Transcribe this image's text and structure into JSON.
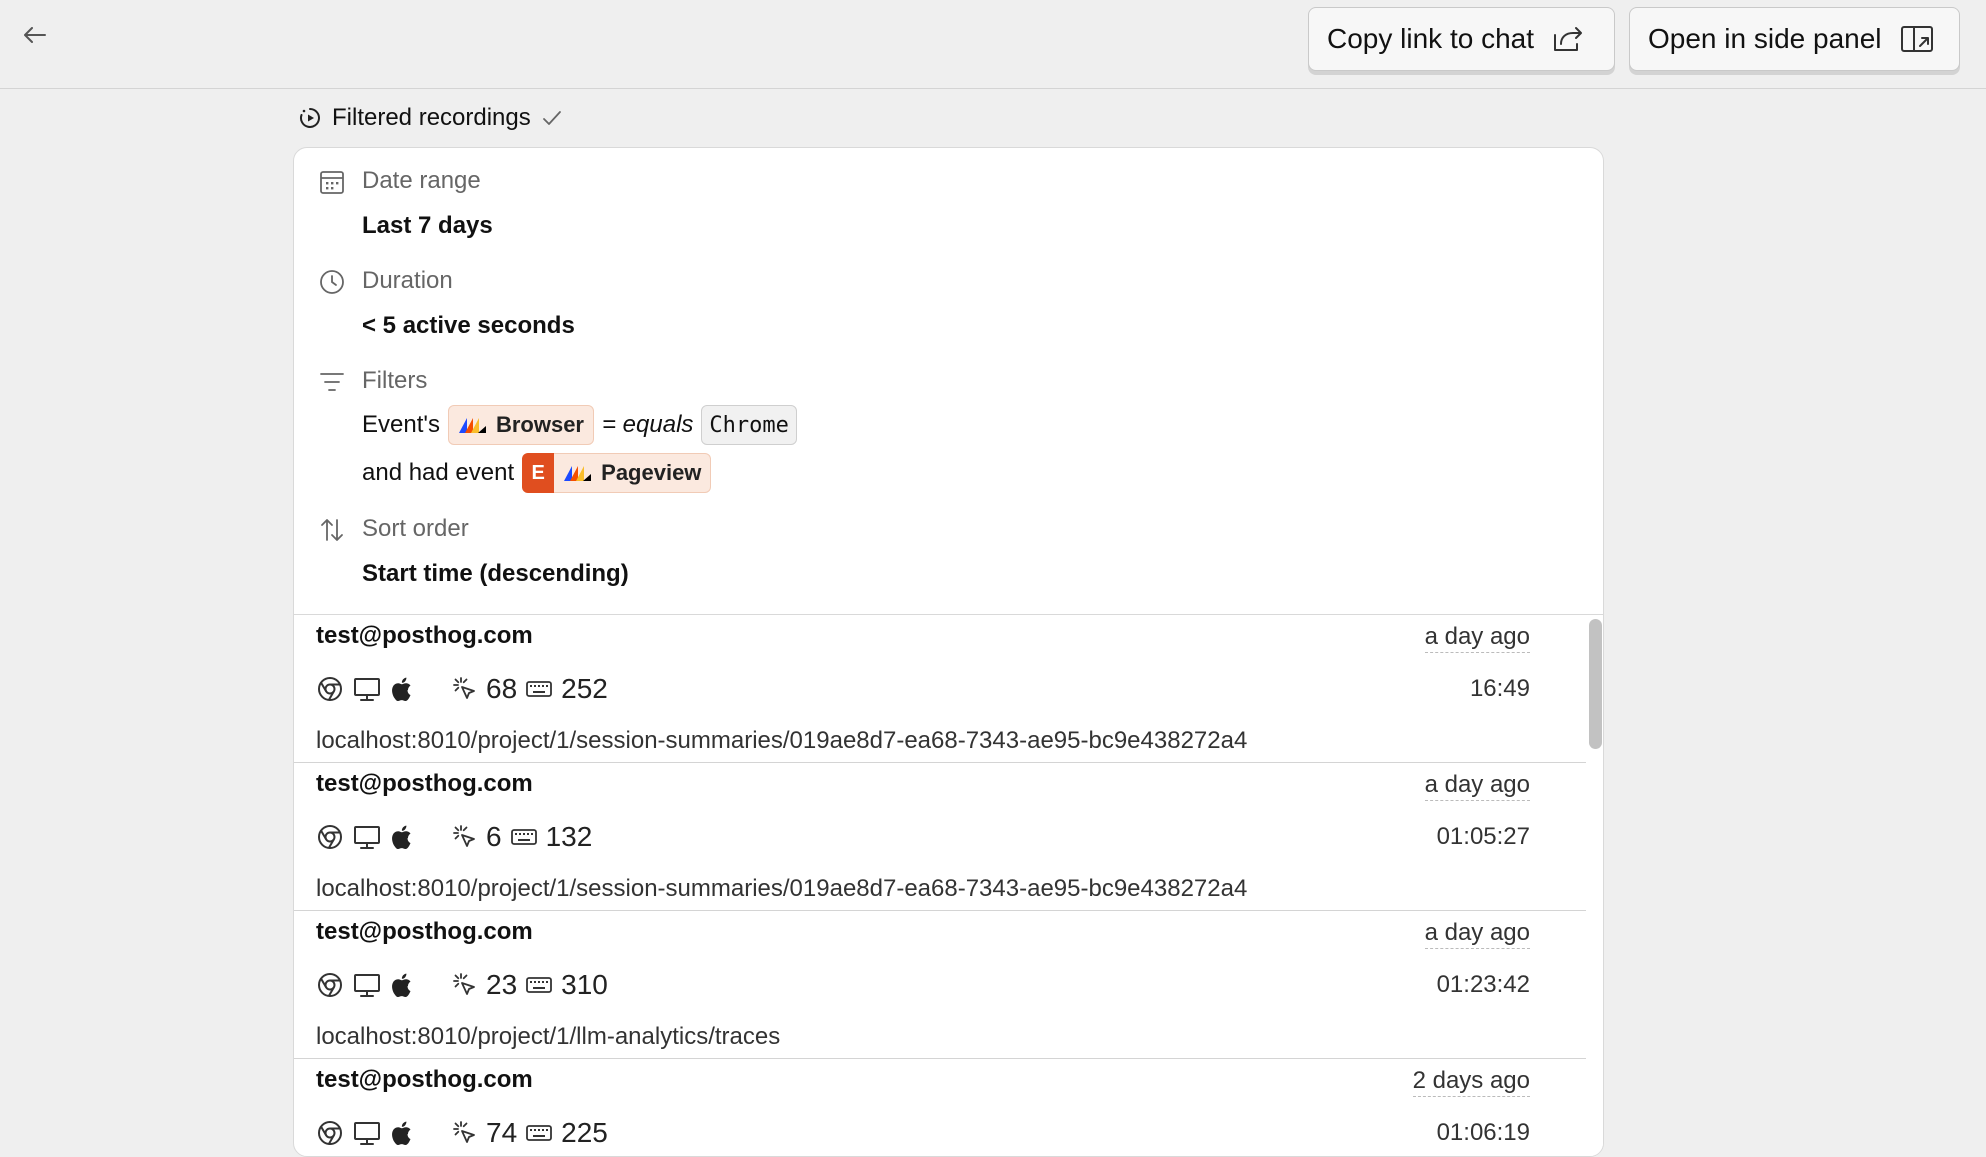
{
  "toolbar": {
    "copy_link_label": "Copy link to chat",
    "side_panel_label": "Open in side panel"
  },
  "section": {
    "title": "Filtered recordings"
  },
  "filters": {
    "date_range_label": "Date range",
    "date_range_value": "Last 7 days",
    "duration_label": "Duration",
    "duration_value": "< 5 active seconds",
    "filters_label": "Filters",
    "property_prefix": "Event's",
    "property_name": "Browser",
    "operator": "= equals",
    "property_value": "Chrome",
    "event_prefix": "and had event",
    "event_badge": "E",
    "event_name": "Pageview",
    "sort_label": "Sort order",
    "sort_value": "Start time (descending)"
  },
  "recordings": [
    {
      "user": "test@posthog.com",
      "ago": "a day ago",
      "clicks": "68",
      "keypresses": "252",
      "duration": "16:49",
      "url": "localhost:8010/project/1/session-summaries/019ae8d7-ea68-7343-ae95-bc9e438272a4"
    },
    {
      "user": "test@posthog.com",
      "ago": "a day ago",
      "clicks": "6",
      "keypresses": "132",
      "duration": "01:05:27",
      "url": "localhost:8010/project/1/session-summaries/019ae8d7-ea68-7343-ae95-bc9e438272a4"
    },
    {
      "user": "test@posthog.com",
      "ago": "a day ago",
      "clicks": "23",
      "keypresses": "310",
      "duration": "01:23:42",
      "url": "localhost:8010/project/1/llm-analytics/traces"
    },
    {
      "user": "test@posthog.com",
      "ago": "2 days ago",
      "clicks": "74",
      "keypresses": "225",
      "duration": "01:06:19",
      "url": ""
    }
  ],
  "icons": {
    "back": "arrow-left-icon",
    "copy_link": "share-icon",
    "side_panel": "side-panel-icon",
    "section": "recording-icon",
    "check": "check-icon",
    "date_range": "calendar-icon",
    "duration": "clock-icon",
    "filters": "filter-icon",
    "sort": "sort-icon",
    "browser": "chrome-icon",
    "device": "desktop-icon",
    "os": "apple-icon",
    "clicks": "click-icon",
    "keypresses": "keyboard-icon"
  },
  "colors": {
    "event_badge": "#e04e1f",
    "property_pill_bg": "#fbe9df",
    "background": "#efefef"
  }
}
